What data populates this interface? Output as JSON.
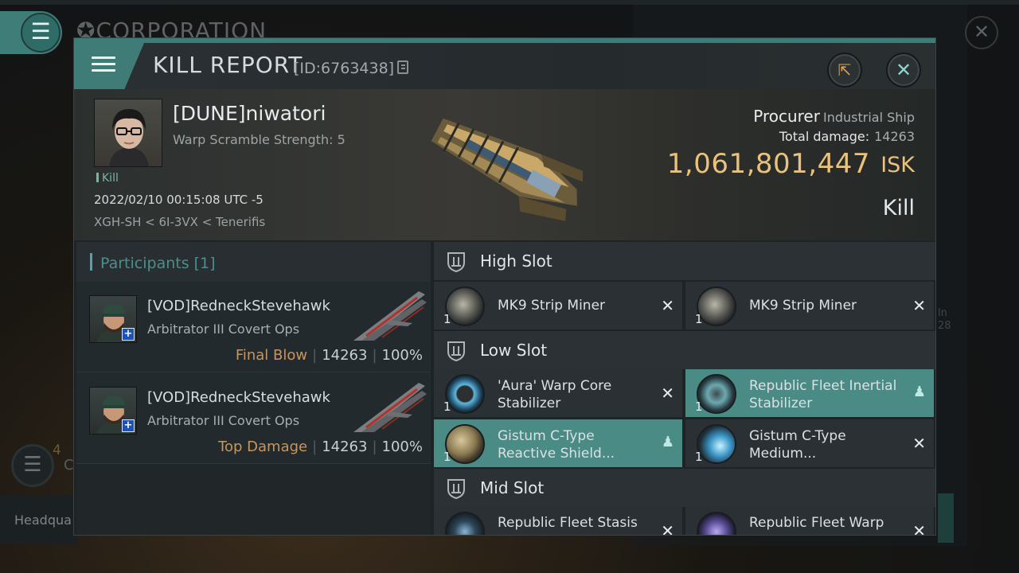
{
  "background": {
    "corp_title": "CORPORATION",
    "badge_count": "4",
    "badge_letter": "C",
    "hq_label": "Headqua",
    "right_partial": "ln\n28"
  },
  "header": {
    "title": "KILL REPORT",
    "report_id": "[ID:6763438]"
  },
  "victim": {
    "name": "[DUNE]niwatori",
    "warp_strength": "Warp Scramble Strength: 5",
    "kill_tag": "Kill",
    "time": "2022/02/10 00:15:08 UTC -5",
    "location": "XGH-SH < 6I-3VX < Tenerifis",
    "ship_name": "Procurer",
    "ship_class": "Industrial Ship",
    "total_damage_label": "Total damage:",
    "total_damage_value": "14263",
    "isk_value": "1,061,801,447",
    "isk_unit": "ISK",
    "result": "Kill"
  },
  "participants": {
    "label": "Participants [1]",
    "items": [
      {
        "name": "[VOD]RedneckStevehawk",
        "ship": "Arbitrator III Covert Ops",
        "tag": "Final Blow",
        "damage": "14263",
        "percent": "100%"
      },
      {
        "name": "[VOD]RedneckStevehawk",
        "ship": "Arbitrator III Covert Ops",
        "tag": "Top Damage",
        "damage": "14263",
        "percent": "100%"
      }
    ]
  },
  "slots": {
    "high": {
      "label": "High Slot",
      "modules": [
        {
          "name": "MK9 Strip Miner",
          "qty": "1",
          "status": "destroyed"
        },
        {
          "name": "MK9 Strip Miner",
          "qty": "1",
          "status": "destroyed"
        }
      ]
    },
    "low": {
      "label": "Low Slot",
      "modules": [
        {
          "name": "'Aura' Warp Core Stabilizer",
          "qty": "1",
          "status": "destroyed"
        },
        {
          "name": "Republic Fleet Inertial Stabilizer",
          "qty": "1",
          "status": "dropped"
        },
        {
          "name": "Gistum C-Type Reactive Shield...",
          "qty": "1",
          "status": "dropped"
        },
        {
          "name": "Gistum C-Type Medium...",
          "qty": "1",
          "status": "destroyed"
        }
      ]
    },
    "mid": {
      "label": "Mid Slot",
      "modules": [
        {
          "name": "Republic Fleet Stasis",
          "qty": "1",
          "status": "destroyed"
        },
        {
          "name": "Republic Fleet Warp",
          "qty": "1",
          "status": "destroyed"
        }
      ]
    }
  },
  "colors": {
    "accent": "#3f7c78",
    "isk": "#ecc17a",
    "dropped_bg": "#4a8b86",
    "final_blow": "#c9955a"
  }
}
